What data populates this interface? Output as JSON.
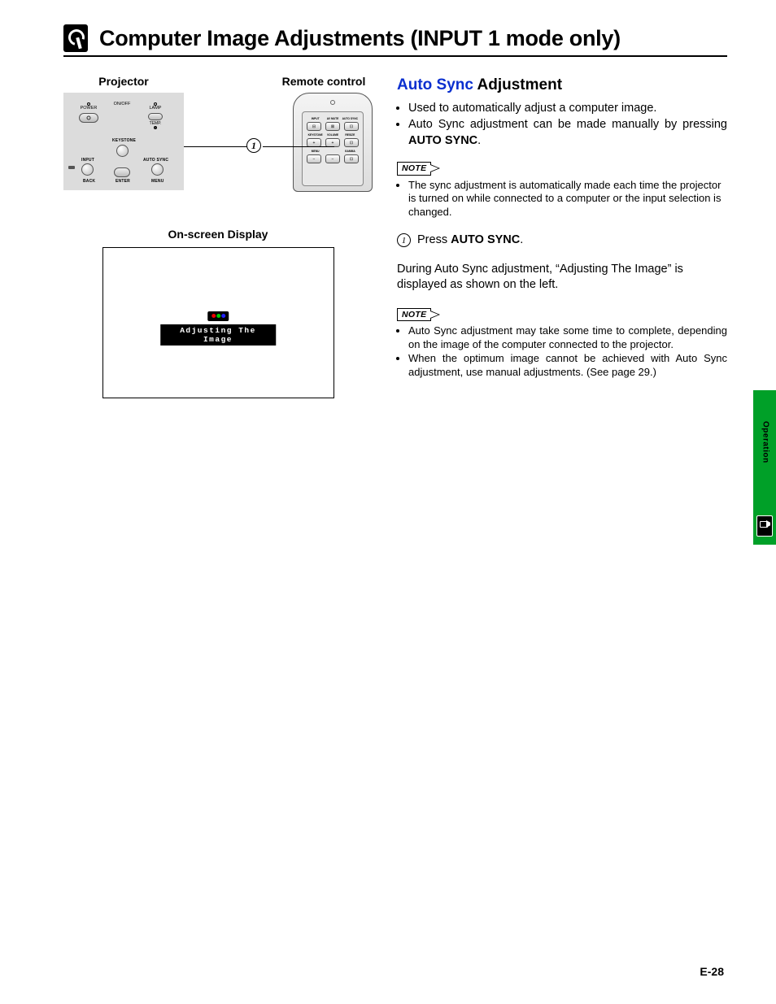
{
  "title": "Computer Image Adjustments (INPUT 1 mode only)",
  "left": {
    "projector_label": "Projector",
    "remote_label": "Remote control",
    "projector_panel": {
      "power": "POWER",
      "onoff": "ON/OFF",
      "lamp": "LAMP",
      "temp": "TEMP.",
      "keystone": "KEYSTONE",
      "input": "INPUT",
      "autosync": "AUTO SYNC",
      "back": "BACK",
      "enter": "ENTER",
      "menu": "MENU"
    },
    "remote": {
      "row1": [
        "INPUT",
        "AV MUTE",
        "AUTO SYNC"
      ],
      "row2": [
        "KEYSTONE",
        "VOLUME",
        "RESIZE"
      ],
      "row3_labels": [
        "MENU",
        "",
        "GAMMA"
      ]
    },
    "callout": "1",
    "osd_label": "On-screen Display",
    "osd_text": "Adjusting The Image"
  },
  "right": {
    "heading_blue": "Auto Sync",
    "heading_rest": " Adjustment",
    "intro_bullets": [
      "Used to automatically adjust a computer image.",
      "Auto Sync adjustment can be made manually by pressing <b>AUTO SYNC</b>."
    ],
    "note_label": "NOTE",
    "note1_bullets": [
      "The sync adjustment is automatically made each time the projector is turned on while connected to a computer or the input selection is changed."
    ],
    "step_num": "1",
    "step_text_pre": "Press ",
    "step_text_bold": "AUTO SYNC",
    "step_text_post": ".",
    "para": "During Auto Sync adjustment, “Adjusting The Image” is displayed as shown on the left.",
    "note2_bullets": [
      "Auto Sync adjustment may take some time to complete, depending on the image of the computer connected to the projector.",
      "When the optimum image cannot be achieved with Auto Sync adjustment, use manual adjustments. (See page 29.)"
    ]
  },
  "side_tab": "Operation",
  "page_number": "E-28"
}
